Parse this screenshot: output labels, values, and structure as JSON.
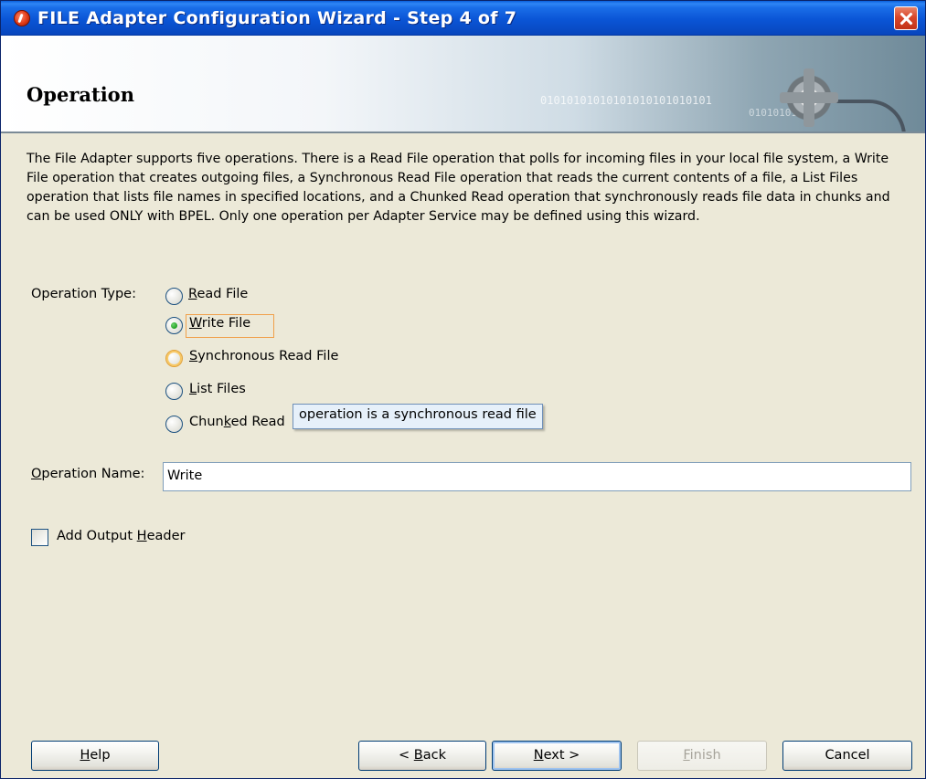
{
  "window": {
    "title": "FILE Adapter Configuration Wizard - Step 4 of 7"
  },
  "banner": {
    "title": "Operation",
    "binary_text": "01010101010101010101010101",
    "binary_text_2": "01010101010"
  },
  "description": "The File Adapter supports five operations.  There is a Read File operation that polls for incoming files in your local file system, a Write File operation that creates outgoing files, a Synchronous Read File operation that reads the current contents of a file, a List Files operation that lists file names in specified locations, and a Chunked Read operation that synchronously reads file data in chunks and can be used ONLY with BPEL. Only one operation per Adapter Service may be defined using this wizard.",
  "operation_type": {
    "label": "Operation Type:",
    "selected": "Write File",
    "options": [
      {
        "key": "R",
        "rest": "ead File"
      },
      {
        "key": "W",
        "rest": "rite File"
      },
      {
        "key": "S",
        "rest": "ynchronous Read File"
      },
      {
        "key": "L",
        "rest": "ist Files"
      },
      {
        "pre": "Chun",
        "key": "k",
        "rest": "ed Read"
      }
    ]
  },
  "tooltip": "operation is a synchronous read file",
  "operation_name": {
    "label_key": "O",
    "label_rest": "peration Name:",
    "value": "Write"
  },
  "add_output_header": {
    "label_pre": "Add Output ",
    "label_key": "H",
    "label_rest": "eader",
    "checked": false
  },
  "buttons": {
    "help_key": "H",
    "help_rest": "elp",
    "back_pre": "< ",
    "back_key": "B",
    "back_rest": "ack",
    "next_key": "N",
    "next_rest": "ext >",
    "finish_key": "F",
    "finish_rest": "inish",
    "cancel": "Cancel"
  }
}
